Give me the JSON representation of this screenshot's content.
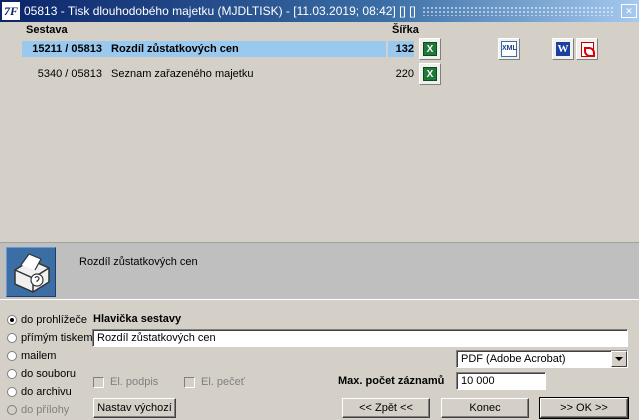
{
  "window": {
    "title": "05813 - Tisk dlouhodobého majetku (MJDLTISK) - [11.03.2019; 08:42] [] []",
    "app_icon": "7F",
    "close_label": "✕"
  },
  "table": {
    "header_sestava": "Sestava",
    "header_sirka": "Šířka",
    "rows": [
      {
        "code": "15211 / 05813",
        "name": "Rozdíl zůstatkových cen",
        "width": "132",
        "selected": true
      },
      {
        "code": "5340 / 05813",
        "name": "Seznam zařazeného majetku",
        "width": "220",
        "selected": false
      }
    ]
  },
  "export_icons": {
    "excel": "X",
    "xml": "XML",
    "word": "W"
  },
  "info": {
    "text": "Rozdíl zůstatkových cen"
  },
  "output_options": [
    {
      "label": "do prohlížeče",
      "checked": true,
      "enabled": true
    },
    {
      "label": "přímým tiskem",
      "checked": false,
      "enabled": true
    },
    {
      "label": "mailem",
      "checked": false,
      "enabled": true
    },
    {
      "label": "do souboru",
      "checked": false,
      "enabled": true
    },
    {
      "label": "do archivu",
      "checked": false,
      "enabled": true
    },
    {
      "label": "do přílohy",
      "checked": false,
      "enabled": false
    }
  ],
  "form": {
    "header_label": "Hlavička sestavy",
    "header_value": "Rozdíl zůstatkových cen",
    "format_selected": "PDF (Adobe Acrobat)",
    "el_podpis": "El. podpis",
    "el_pecet": "El. pečeť",
    "max_records_label": "Max. počet záznamů",
    "max_records_value": "10 000"
  },
  "buttons": {
    "defaults": "Nastav výchozí",
    "back": "<< Zpět <<",
    "end": "Konec",
    "ok": ">> OK >>"
  },
  "colors": {
    "selection": "#99c9ef",
    "titlebar": "#0a246a",
    "excel_green": "#1f7a3a",
    "info_panel": "#bfbfbf"
  }
}
